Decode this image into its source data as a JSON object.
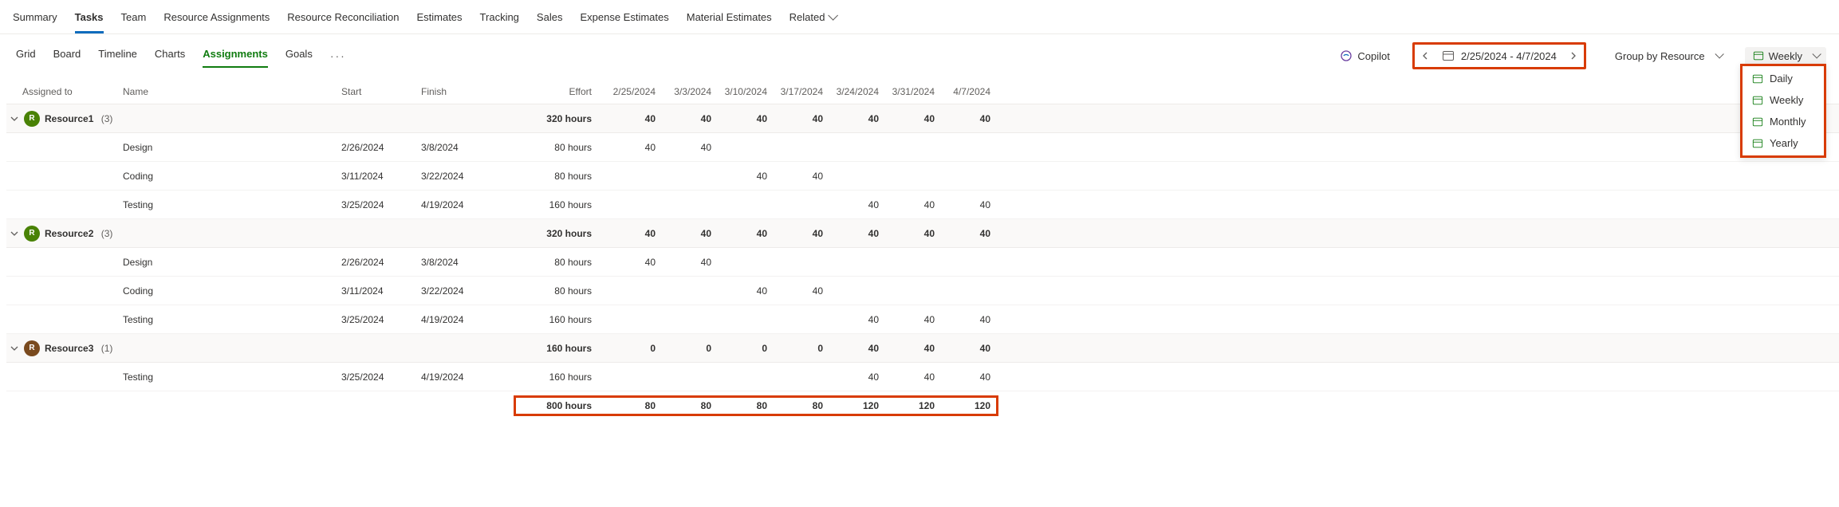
{
  "topTabs": [
    "Summary",
    "Tasks",
    "Team",
    "Resource Assignments",
    "Resource Reconciliation",
    "Estimates",
    "Tracking",
    "Sales",
    "Expense Estimates",
    "Material Estimates",
    "Related"
  ],
  "topActive": "Tasks",
  "subTabs": [
    "Grid",
    "Board",
    "Timeline",
    "Charts",
    "Assignments",
    "Goals"
  ],
  "subActive": "Assignments",
  "copilot": "Copilot",
  "dateRange": "2/25/2024 - 4/7/2024",
  "groupBy": "Group by Resource",
  "timescale": "Weekly",
  "timescaleOptions": [
    "Daily",
    "Weekly",
    "Monthly",
    "Yearly"
  ],
  "columns": {
    "assigned": "Assigned to",
    "name": "Name",
    "start": "Start",
    "finish": "Finish",
    "effort": "Effort",
    "periods": [
      "2/25/2024",
      "3/3/2024",
      "3/10/2024",
      "3/17/2024",
      "3/24/2024",
      "3/31/2024",
      "4/7/2024"
    ]
  },
  "groups": [
    {
      "label": "Resource1",
      "count": "(3)",
      "avatarClass": "r1",
      "avatarLetter": "R",
      "effort": "320 hours",
      "values": [
        "40",
        "40",
        "40",
        "40",
        "40",
        "40",
        "40"
      ],
      "tasks": [
        {
          "name": "Design",
          "start": "2/26/2024",
          "finish": "3/8/2024",
          "effort": "80 hours",
          "values": [
            "40",
            "40",
            "",
            "",
            "",
            "",
            ""
          ]
        },
        {
          "name": "Coding",
          "start": "3/11/2024",
          "finish": "3/22/2024",
          "effort": "80 hours",
          "values": [
            "",
            "",
            "40",
            "40",
            "",
            "",
            ""
          ]
        },
        {
          "name": "Testing",
          "start": "3/25/2024",
          "finish": "4/19/2024",
          "effort": "160 hours",
          "values": [
            "",
            "",
            "",
            "",
            "40",
            "40",
            "40"
          ]
        }
      ]
    },
    {
      "label": "Resource2",
      "count": "(3)",
      "avatarClass": "r2",
      "avatarLetter": "R",
      "effort": "320 hours",
      "values": [
        "40",
        "40",
        "40",
        "40",
        "40",
        "40",
        "40"
      ],
      "tasks": [
        {
          "name": "Design",
          "start": "2/26/2024",
          "finish": "3/8/2024",
          "effort": "80 hours",
          "values": [
            "40",
            "40",
            "",
            "",
            "",
            "",
            ""
          ]
        },
        {
          "name": "Coding",
          "start": "3/11/2024",
          "finish": "3/22/2024",
          "effort": "80 hours",
          "values": [
            "",
            "",
            "40",
            "40",
            "",
            "",
            ""
          ]
        },
        {
          "name": "Testing",
          "start": "3/25/2024",
          "finish": "4/19/2024",
          "effort": "160 hours",
          "values": [
            "",
            "",
            "",
            "",
            "40",
            "40",
            "40"
          ]
        }
      ]
    },
    {
      "label": "Resource3",
      "count": "(1)",
      "avatarClass": "r3",
      "avatarLetter": "R",
      "effort": "160 hours",
      "values": [
        "0",
        "0",
        "0",
        "0",
        "40",
        "40",
        "40"
      ],
      "tasks": [
        {
          "name": "Testing",
          "start": "3/25/2024",
          "finish": "4/19/2024",
          "effort": "160 hours",
          "values": [
            "",
            "",
            "",
            "",
            "40",
            "40",
            "40"
          ]
        }
      ]
    }
  ],
  "totals": {
    "effort": "800 hours",
    "values": [
      "80",
      "80",
      "80",
      "80",
      "120",
      "120",
      "120"
    ]
  }
}
